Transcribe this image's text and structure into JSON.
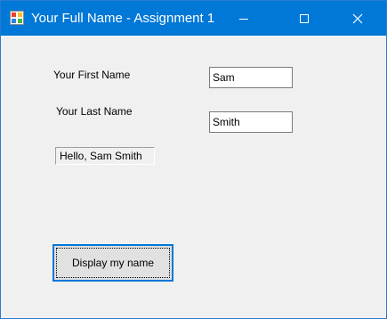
{
  "window": {
    "title": "Your Full Name - Assignment 1",
    "app_icon": "winforms-app-icon",
    "controls": {
      "minimize_icon": "minimize-icon",
      "maximize_icon": "maximize-icon",
      "close_icon": "close-icon"
    },
    "accent_color": "#0078d7"
  },
  "form": {
    "first_name_label": "Your First Name",
    "first_name_value": "Sam",
    "last_name_label": "Your Last Name",
    "last_name_value": "Smith",
    "greeting": "Hello, Sam Smith",
    "display_button_label": "Display my name"
  }
}
